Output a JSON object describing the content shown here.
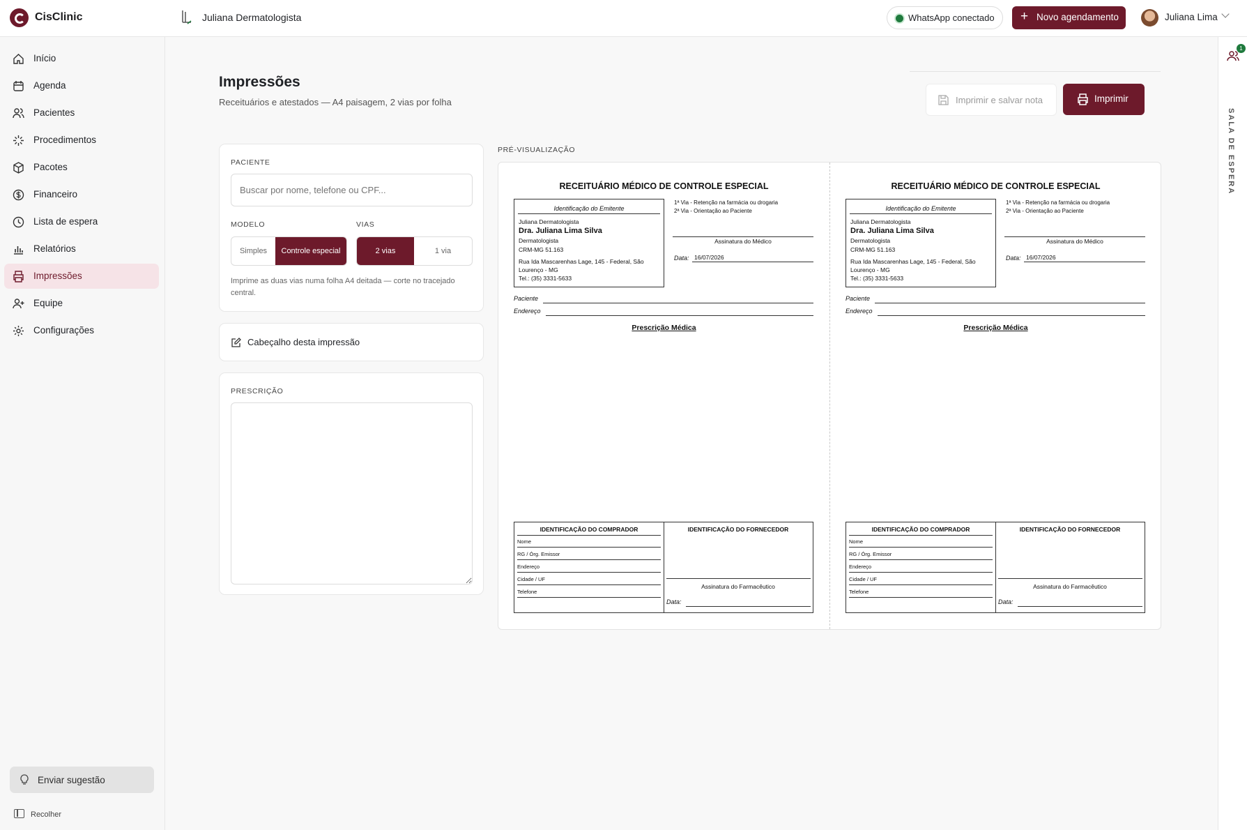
{
  "app": {
    "brand": "CisClinic",
    "clinic": "Juliana Dermatologista"
  },
  "header": {
    "whatsapp": "WhatsApp conectado",
    "new_appointment": "Novo agendamento",
    "user": "Juliana Lima"
  },
  "sidebar": {
    "items": [
      {
        "label": "Início",
        "icon": "home-icon"
      },
      {
        "label": "Agenda",
        "icon": "calendar-icon"
      },
      {
        "label": "Pacientes",
        "icon": "users-icon"
      },
      {
        "label": "Procedimentos",
        "icon": "sparkle-icon"
      },
      {
        "label": "Pacotes",
        "icon": "package-icon"
      },
      {
        "label": "Financeiro",
        "icon": "dollar-icon"
      },
      {
        "label": "Lista de espera",
        "icon": "clock-icon"
      },
      {
        "label": "Relatórios",
        "icon": "chart-icon"
      },
      {
        "label": "Impressões",
        "icon": "printer-icon",
        "active": true
      },
      {
        "label": "Equipe",
        "icon": "user-plus-icon"
      },
      {
        "label": "Configurações",
        "icon": "gear-icon"
      }
    ],
    "suggest": "Enviar sugestão",
    "collapse": "Recolher"
  },
  "page": {
    "title": "Impressões",
    "subtitle": "Receituários e atestados — A4 paisagem, 2 vias por folha",
    "save_print": "Imprimir e salvar nota",
    "print": "Imprimir"
  },
  "form": {
    "patient_label": "PACIENTE",
    "patient_placeholder": "Buscar por nome, telefone ou CPF...",
    "model_label": "MODELO",
    "model_options": [
      "Simples",
      "Controle especial"
    ],
    "model_selected": "Controle especial",
    "copies_label": "VIAS",
    "copies_options": [
      "2 vias",
      "1 via"
    ],
    "copies_selected": "2 vias",
    "hint_line1": "Imprime as duas vias numa folha A4 deitada — corte no tracejado",
    "hint_line2": "central.",
    "header_edit": "Cabeçalho desta impressão",
    "prescription_label": "PRESCRIÇÃO",
    "prescription_value": ""
  },
  "preview": {
    "label": "PRÉ-VISUALIZAÇÃO",
    "title": "RECEITUÁRIO MÉDICO DE CONTROLE ESPECIAL",
    "emitente_header": "Identificação do Emitente",
    "clinic": "Juliana Dermatologista",
    "doctor": "Dra. Juliana Lima Silva",
    "specialty": "Dermatologista",
    "crm": "CRM-MG 51.163",
    "address_line1": "Rua Ida Mascarenhas Lage, 145 - Federal, São",
    "address_line2": "Lourenço - MG",
    "phone": "Tel.: (35) 3331-5633",
    "via1": "1ª Via - Retenção na farmácia ou drogaria",
    "via2": "2ª Via - Orientação ao Paciente",
    "signature": "Assinatura do Médico",
    "date_label": "Data:",
    "date": "16/07/2026",
    "patient": "Paciente",
    "address": "Endereço",
    "prescription_title": "Prescrição Médica",
    "buyer_header": "IDENTIFICAÇÃO DO COMPRADOR",
    "supplier_header": "IDENTIFICAÇÃO DO FORNECEDOR",
    "buyer_fields": [
      "Nome",
      "RG / Órg. Emissor",
      "Endereço",
      "Cidade / UF",
      "Telefone"
    ],
    "pharmacist": "Assinatura do Farmacêutico"
  },
  "rail": {
    "label": "SALA DE ESPERA",
    "badge": "1"
  },
  "colors": {
    "brand": "#6d1a2b",
    "active_bg": "#f6e3e7",
    "online": "#1f7a3d"
  }
}
